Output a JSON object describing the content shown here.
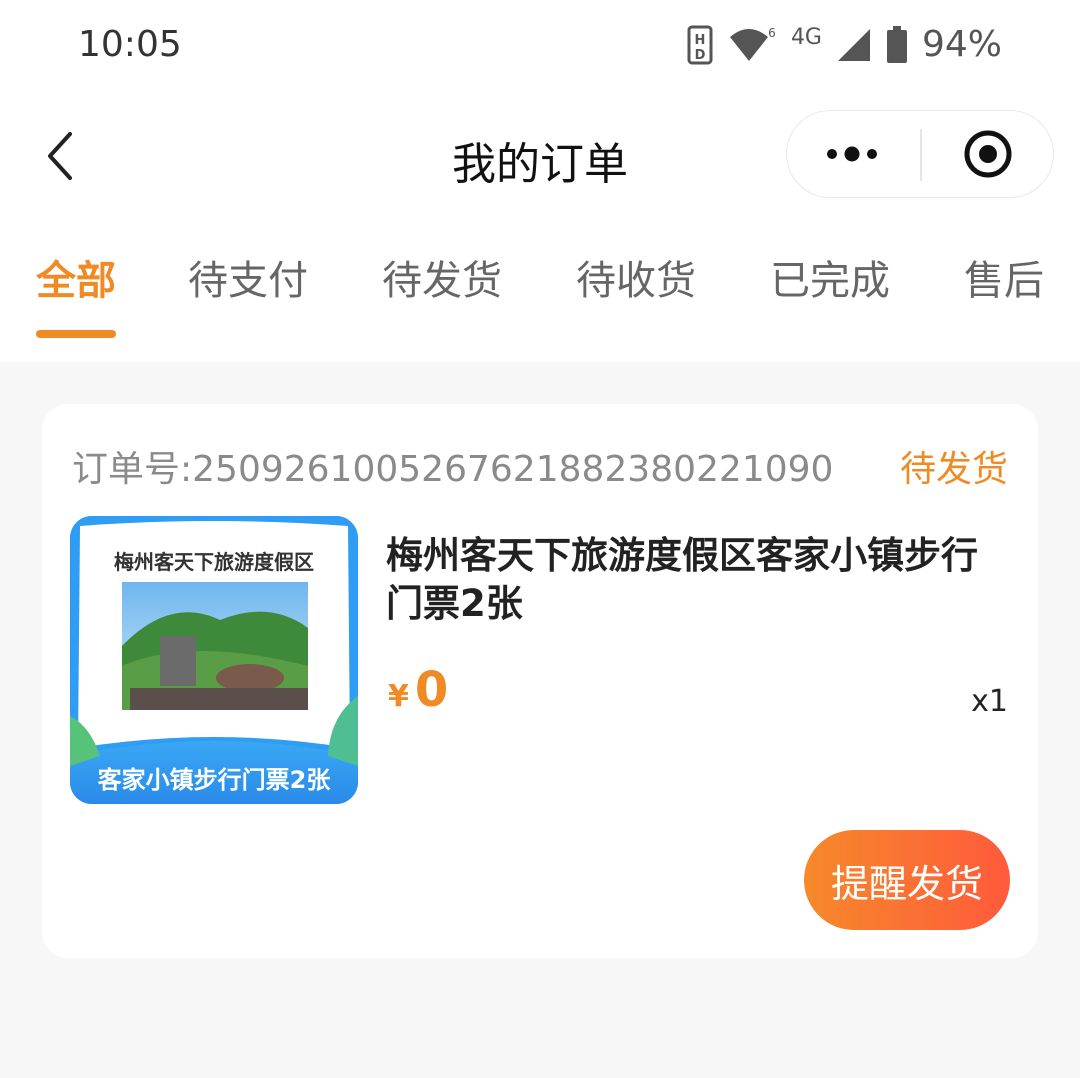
{
  "status_bar": {
    "time": "10:05",
    "network": "4G",
    "battery": "94%",
    "icons": [
      "hd-icon",
      "wifi-icon",
      "signal-icon",
      "battery-icon"
    ]
  },
  "nav": {
    "title": "我的订单",
    "back_icon": "chevron-left-icon",
    "more_icon": "more-dots-icon",
    "close_icon": "target-circle-icon"
  },
  "tabs": [
    {
      "label": "全部",
      "active": true
    },
    {
      "label": "待支付",
      "active": false
    },
    {
      "label": "待发货",
      "active": false
    },
    {
      "label": "待收货",
      "active": false
    },
    {
      "label": "已完成",
      "active": false
    },
    {
      "label": "售后",
      "active": false
    }
  ],
  "order": {
    "order_no": "订单号:2509261005267621882380221090",
    "status": "待发货",
    "product": {
      "thumb_top_text": "梅州客天下旅游度假区",
      "thumb_bottom_text": "客家小镇步行门票2张",
      "title": "梅州客天下旅游度假区客家小镇步行门票2张",
      "price_symbol": "¥",
      "price": "0",
      "quantity": "x1"
    },
    "action_label": "提醒发货"
  },
  "colors": {
    "accent": "#f08a24",
    "button_gradient_start": "#f6892a",
    "button_gradient_end": "#ff5a3c",
    "page_bg": "#f7f7f7"
  }
}
